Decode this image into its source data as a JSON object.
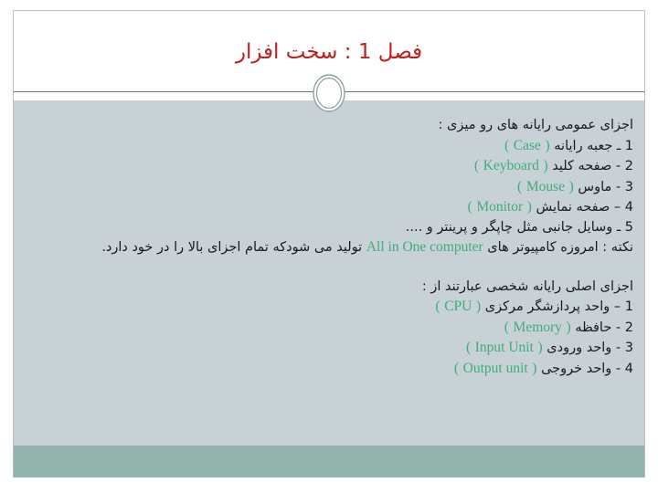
{
  "slide": {
    "title": "فصل 1 : سخت افزار",
    "title_color": "#C0201C",
    "body_bg": "#C8D1D6",
    "footer_color": "#93B3AD",
    "accent_en_color": "#3DAE7C",
    "ornament_name": "oval-ornament"
  },
  "body": {
    "section1": {
      "heading": "اجزای عمومی رایانه های رو میزی :",
      "items": [
        {
          "num": "1",
          "sep": "ـ",
          "fa": "جعبه رایانه",
          "paren_open": "(",
          "en": "Case",
          "paren_close": ")"
        },
        {
          "num": "2",
          "sep": "-",
          "fa": "صفحه کلید",
          "paren_open": "(",
          "en": "Keyboard",
          "paren_close": ")"
        },
        {
          "num": "3",
          "sep": "-",
          "fa": "ماوس",
          "paren_open": "(",
          "en": "Mouse",
          "paren_close": ")"
        },
        {
          "num": "4",
          "sep": "–",
          "fa": "صفحه نمایش",
          "paren_open": "(",
          "en": "Monitor",
          "paren_close": ")"
        },
        {
          "num": "5",
          "sep": "ـ",
          "fa": "وسایل جانبی  مثل چاپگر و پرینتر و ....",
          "paren_open": "",
          "en": "",
          "paren_close": ""
        }
      ],
      "note_prefix": "نکته : امروزه کامپیوتر های",
      "note_en": "All in One computer",
      "note_suffix": "تولید می شودکه تمام اجزای بالا را در خود دارد."
    },
    "section2": {
      "heading": "اجزای اصلی رایانه شخصی عبارتند از :",
      "items": [
        {
          "num": "1",
          "sep": "–",
          "fa": "واحد پردازشگر مرکزی",
          "paren_open": "(",
          "en": "CPU",
          "paren_close": ")"
        },
        {
          "num": "2",
          "sep": "-",
          "fa": "حافظه",
          "paren_open": "(",
          "en": "Memory",
          "paren_close": ")"
        },
        {
          "num": "3",
          "sep": "-",
          "fa": "واحد ورودی",
          "paren_open": "(",
          "en": "Input Unit",
          "paren_close": ")"
        },
        {
          "num": "4",
          "sep": "-",
          "fa": "واحد خروجی",
          "paren_open": "(",
          "en": "Output unit",
          "paren_close": ")"
        }
      ]
    }
  }
}
